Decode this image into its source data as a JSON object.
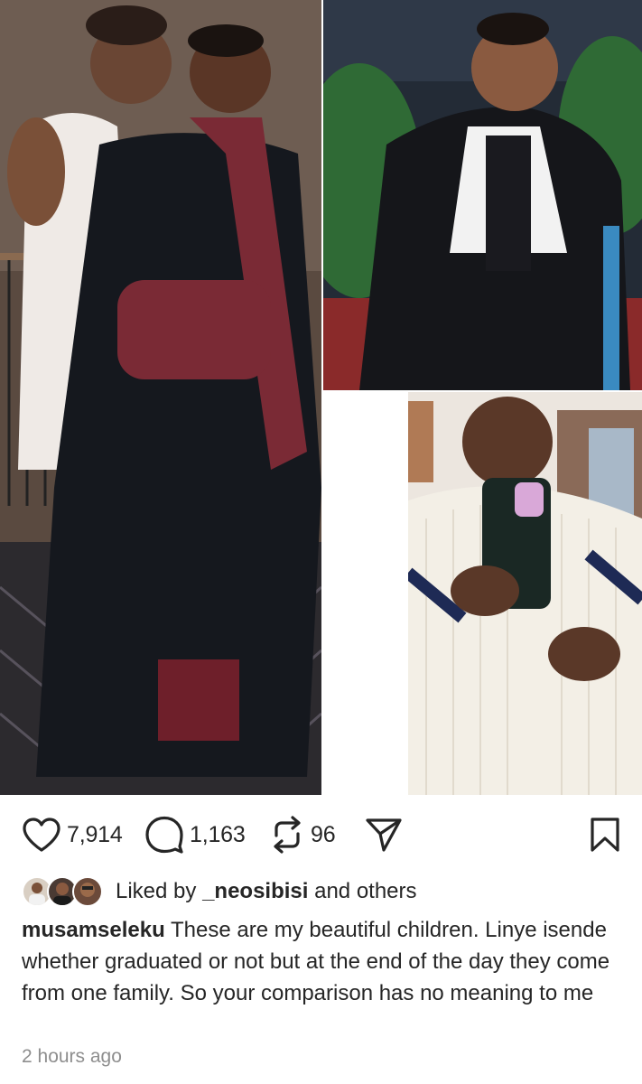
{
  "post": {
    "images": [
      {
        "name": "graduation-photo"
      },
      {
        "name": "gown-portrait-photo"
      },
      {
        "name": "mirror-selfie-photo"
      }
    ],
    "actions": {
      "likes": "7,914",
      "comments": "1,163",
      "reposts": "96"
    },
    "liked_by": {
      "prefix": "Liked by",
      "user": "_neosibisi",
      "suffix": "and others"
    },
    "caption": {
      "username": "musamseleku",
      "text": "These are my beautiful children. Linye isende whether graduated or not but at the end of the day they come from one family. So your comparison has no meaning to me"
    },
    "timestamp": "2 hours ago",
    "icons": {
      "like": "heart-icon",
      "comment": "comment-bubble-icon",
      "repost": "repost-icon",
      "share": "send-icon",
      "save": "bookmark-icon"
    }
  }
}
